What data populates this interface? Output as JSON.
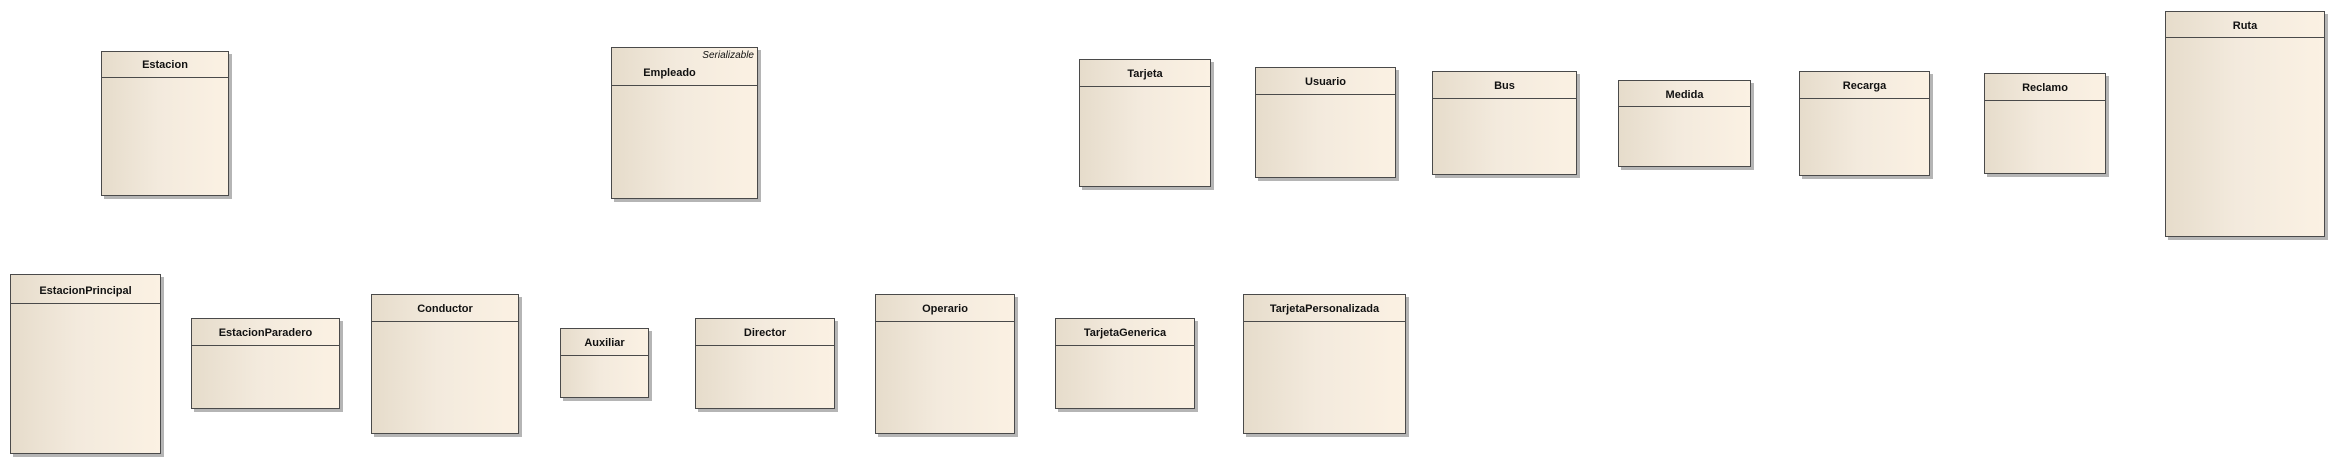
{
  "diagram": {
    "classes": {
      "estacion": {
        "name": "Estacion"
      },
      "empleado": {
        "name": "Empleado",
        "stereotype": "Serializable"
      },
      "tarjeta": {
        "name": "Tarjeta"
      },
      "usuario": {
        "name": "Usuario"
      },
      "bus": {
        "name": "Bus"
      },
      "medida": {
        "name": "Medida"
      },
      "recarga": {
        "name": "Recarga"
      },
      "reclamo": {
        "name": "Reclamo"
      },
      "ruta": {
        "name": "Ruta"
      },
      "estacion_principal": {
        "name": "EstacionPrincipal"
      },
      "estacion_paradero": {
        "name": "EstacionParadero"
      },
      "conductor": {
        "name": "Conductor"
      },
      "auxiliar": {
        "name": "Auxiliar"
      },
      "director": {
        "name": "Director"
      },
      "operario": {
        "name": "Operario"
      },
      "tarjeta_generica": {
        "name": "TarjetaGenerica"
      },
      "tarjeta_personalizada": {
        "name": "TarjetaPersonalizada"
      }
    }
  }
}
